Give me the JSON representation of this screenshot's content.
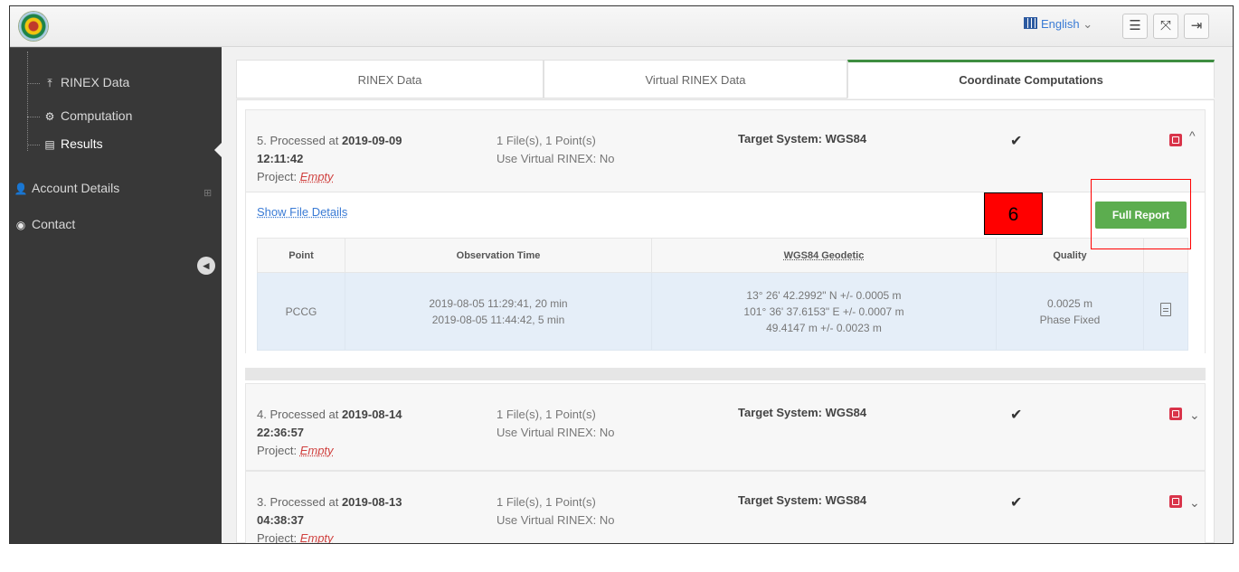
{
  "header": {
    "language": "English",
    "language_caret": "⌄",
    "menu_glyph": "☰",
    "fullscreen_glyph": "⤧",
    "logout_glyph": "⇥"
  },
  "sidebar": {
    "items": [
      {
        "label": "RINEX Data",
        "icon": "upload-icon",
        "glyph": "⤒"
      },
      {
        "label": "Computation",
        "icon": "gear-icon",
        "glyph": "⚙"
      },
      {
        "label": "Results",
        "icon": "table-icon",
        "glyph": "▤"
      },
      {
        "label": "Account Details",
        "icon": "user-icon",
        "glyph": "👤"
      },
      {
        "label": "Contact",
        "icon": "contact-icon",
        "glyph": "◉"
      }
    ],
    "active_item": "Results",
    "collapse_glyph": "◂",
    "expand_glyph": "⊞"
  },
  "tabs": [
    {
      "label": "RINEX Data",
      "active": false
    },
    {
      "label": "Virtual RINEX Data",
      "active": false
    },
    {
      "label": "Coordinate Computations",
      "active": true
    }
  ],
  "results": [
    {
      "title_prefix": "5. Processed at",
      "date": "2019-09-09",
      "time": "12:11:42",
      "project_label": "Project:",
      "project_value": "Empty",
      "files": "1 File(s), 1 Point(s)",
      "virtual": "Use Virtual RINEX: No",
      "target": "Target System: WGS84",
      "check": "✔",
      "chevron": "^",
      "expanded": true
    },
    {
      "title_prefix": "4. Processed at",
      "date": "2019-08-14",
      "time": "22:36:57",
      "project_label": "Project:",
      "project_value": "Empty",
      "files": "1 File(s), 1 Point(s)",
      "virtual": "Use Virtual RINEX: No",
      "target": "Target System: WGS84",
      "check": "✔",
      "chevron": "⌄",
      "expanded": false
    },
    {
      "title_prefix": "3. Processed at",
      "date": "2019-08-13",
      "time": "04:38:37",
      "project_label": "Project:",
      "project_value": "Empty",
      "files": "1 File(s), 1 Point(s)",
      "virtual": "Use Virtual RINEX: No",
      "target": "Target System: WGS84",
      "check": "✔",
      "chevron": "⌄",
      "expanded": false
    }
  ],
  "details": {
    "show_file_details": "Show File Details",
    "full_report": "Full Report",
    "columns": [
      "Point",
      "Observation Time",
      "WGS84 Geodetic",
      "Quality"
    ],
    "row": {
      "point": "PCCG",
      "obs_time_1": "2019-08-05 11:29:41, 20 min",
      "obs_time_2": "2019-08-05 11:44:42, 5 min",
      "geo_1": "13° 26' 42.2992\" N +/- 0.0005 m",
      "geo_2": "101° 36' 37.6153\" E +/- 0.0007 m",
      "geo_3": "49.4147 m +/- 0.0023 m",
      "quality_1": "0.0025 m",
      "quality_2": "Phase Fixed"
    }
  },
  "annotation": {
    "number": "6"
  },
  "colors": {
    "sidebar_bg": "#383838",
    "accent_green": "#5cad4f",
    "pdf_red": "#d9344a",
    "link_blue": "#3a7bd5",
    "annotation_red": "#ff0000"
  }
}
